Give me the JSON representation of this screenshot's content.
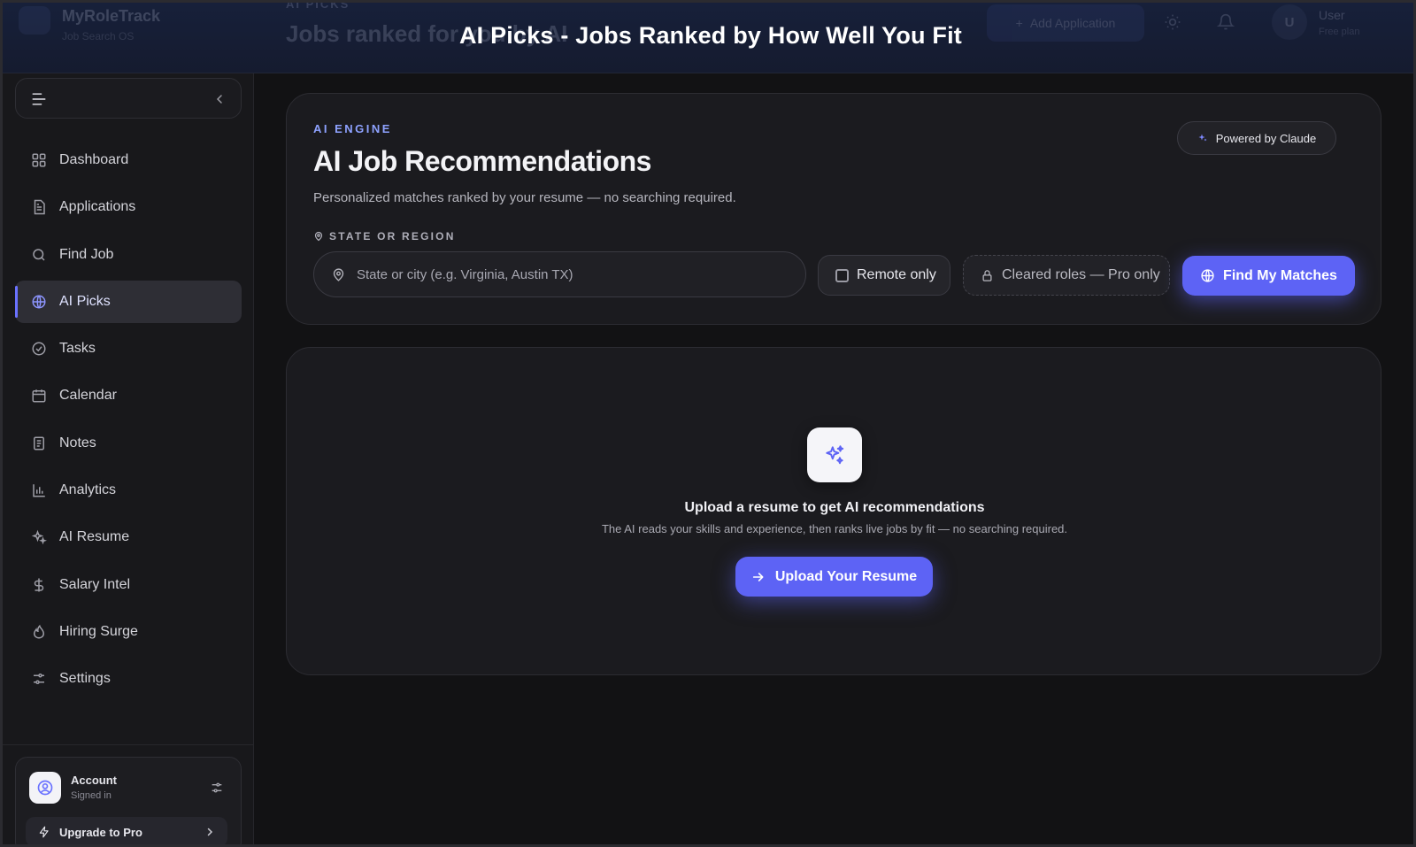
{
  "overlay_title": "AI Picks - Jobs Ranked by How Well You Fit",
  "topbar": {
    "brand_name": "MyRoleTrack",
    "brand_sub": "Job Search OS",
    "crumb_small": "AI PICKS",
    "crumb_title": "Jobs ranked for you by AI",
    "add_button": "Add Application",
    "user_initial": "U",
    "user_name": "User",
    "user_plan": "Free plan"
  },
  "sidebar": {
    "items": [
      {
        "label": "Dashboard",
        "icon": "grid-icon"
      },
      {
        "label": "Applications",
        "icon": "document-icon"
      },
      {
        "label": "Find Job",
        "icon": "search-icon"
      },
      {
        "label": "AI Picks",
        "icon": "globe-icon",
        "active": true
      },
      {
        "label": "Tasks",
        "icon": "check-circle-icon"
      },
      {
        "label": "Calendar",
        "icon": "calendar-icon"
      },
      {
        "label": "Notes",
        "icon": "notes-icon"
      },
      {
        "label": "Analytics",
        "icon": "bar-chart-icon"
      },
      {
        "label": "AI Resume",
        "icon": "sparkle-icon"
      },
      {
        "label": "Salary Intel",
        "icon": "dollar-icon"
      },
      {
        "label": "Hiring Surge",
        "icon": "flame-icon"
      },
      {
        "label": "Settings",
        "icon": "sliders-icon"
      }
    ],
    "account": {
      "name": "Account",
      "status": "Signed in",
      "upgrade_label": "Upgrade to Pro"
    }
  },
  "main": {
    "eyebrow": "AI ENGINE",
    "title": "AI Job Recommendations",
    "subtitle": "Personalized matches ranked by your resume — no searching required.",
    "powered_by": "Powered by Claude",
    "region_label": "STATE OR REGION",
    "region_placeholder": "State or city (e.g. Virginia, Austin TX)",
    "region_value": "",
    "remote_only_label": "Remote only",
    "remote_only_checked": false,
    "cleared_roles_label": "Cleared roles — Pro only",
    "find_button": "Find My Matches",
    "empty_state": {
      "title": "Upload a resume to get AI recommendations",
      "description": "The AI reads your skills and experience, then ranks live jobs by fit — no searching required.",
      "button": "Upload Your Resume"
    }
  },
  "colors": {
    "accent": "#5d63f5",
    "eyebrow": "#8ea2ff",
    "background": "#121214",
    "panel": "#1b1b1f"
  }
}
